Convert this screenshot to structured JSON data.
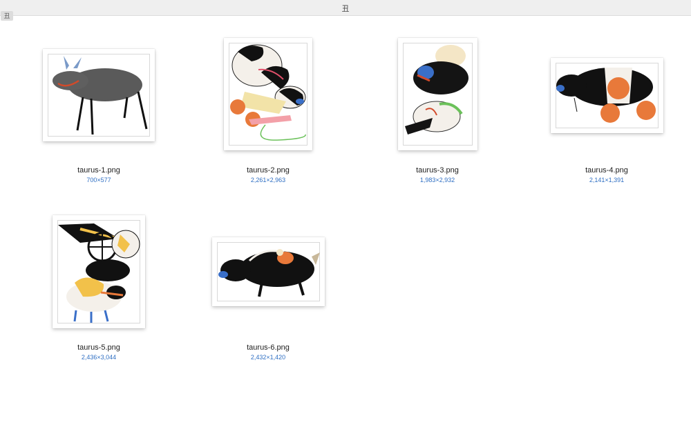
{
  "window": {
    "title": "丑",
    "sidebar_tag": "丑"
  },
  "files": [
    {
      "name": "taurus-1.png",
      "dimensions": "700×577"
    },
    {
      "name": "taurus-2.png",
      "dimensions": "2,261×2,963"
    },
    {
      "name": "taurus-3.png",
      "dimensions": "1,983×2,932"
    },
    {
      "name": "taurus-4.png",
      "dimensions": "2,141×1,391"
    },
    {
      "name": "taurus-5.png",
      "dimensions": "2,436×3,044"
    },
    {
      "name": "taurus-6.png",
      "dimensions": "2,432×1,420"
    }
  ]
}
